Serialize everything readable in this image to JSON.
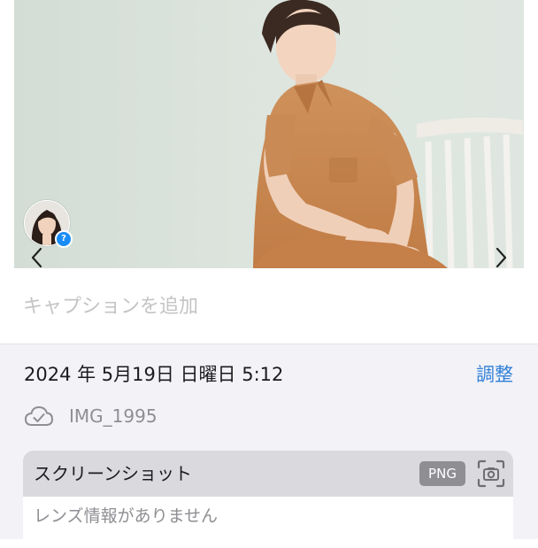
{
  "photo": {
    "background_color": "#d9e2da",
    "shirt_color": "#c98a55"
  },
  "caption": {
    "placeholder": "キャプションを追加"
  },
  "info": {
    "date_time": "2024 年 5月19日 日曜日 5:12",
    "adjust_label": "調整",
    "file_name": "IMG_1995",
    "card_title": "スクリーンショット",
    "format_badge": "PNG",
    "lens_info": "レンズ情報がありません"
  },
  "colors": {
    "accent": "#2f7fd8",
    "badge": "#1a8cf5",
    "panel": "#f2f2f7"
  },
  "icons": {
    "prev": "chevron-left-icon",
    "next": "chevron-right-icon",
    "cloud": "icloud-check-icon",
    "screenshot": "screenshot-camera-icon",
    "avatar_badge": "question-icon"
  },
  "avatar_badge_symbol": "?"
}
